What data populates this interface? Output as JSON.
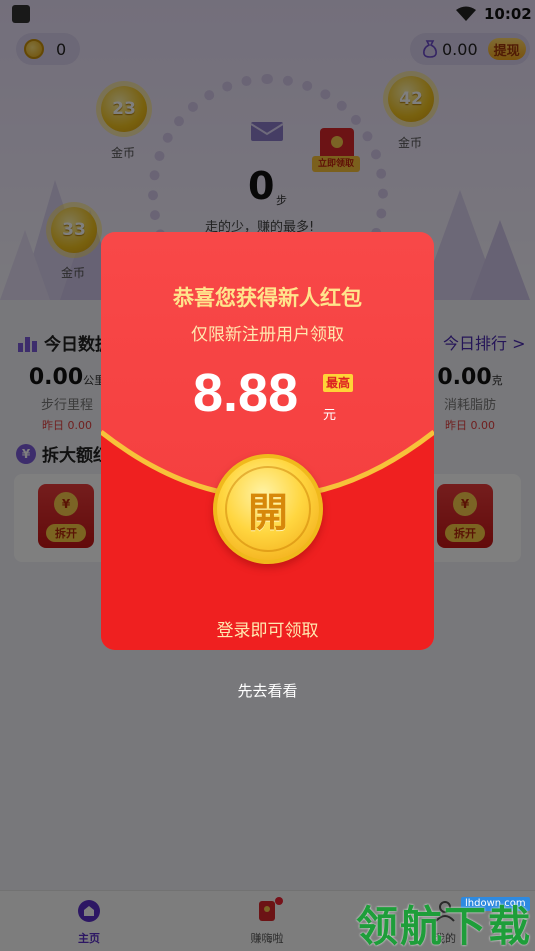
{
  "status": {
    "time": "10:02"
  },
  "header": {
    "coins": "0",
    "balance": "0.00",
    "withdraw_label": "提现"
  },
  "steps": {
    "count": "0",
    "unit": "步",
    "slogan": "走的少，赚的最多!",
    "redbag_tag": "立即领取"
  },
  "float_coins": [
    {
      "value": "23",
      "label": "金币"
    },
    {
      "value": "42",
      "label": "金币"
    },
    {
      "value": "33",
      "label": "金币"
    }
  ],
  "today": {
    "title": "今日数据",
    "rank_link": "今日排行 >",
    "left_stat": {
      "value": "0.00",
      "unit": "公里",
      "label": "步行里程",
      "yesterday": "昨日 0.00"
    },
    "right_stat": {
      "value": "0.00",
      "unit": "克",
      "label": "消耗脂肪",
      "yesterday": "昨日 0.00"
    }
  },
  "split": {
    "title": "拆大额红包",
    "bag_label": "拆开",
    "bag_coin": "¥"
  },
  "tabbar": {
    "home": "主页",
    "earn": "赚嗨啦",
    "mine": "我的"
  },
  "modal": {
    "title": "恭喜您获得新人红包",
    "subtitle": "仅限新注册用户领取",
    "amount": "8.88",
    "badge": "最高",
    "unit": "元",
    "open_label": "開",
    "login_label": "登录即可领取",
    "look_label": "先去看看"
  },
  "watermark": {
    "site": "lhdown.com",
    "text": "领航下载"
  },
  "colors": {
    "modal_red": "#f33b3b",
    "gold": "#ffd640",
    "accent_purple": "#5a2fc8"
  }
}
